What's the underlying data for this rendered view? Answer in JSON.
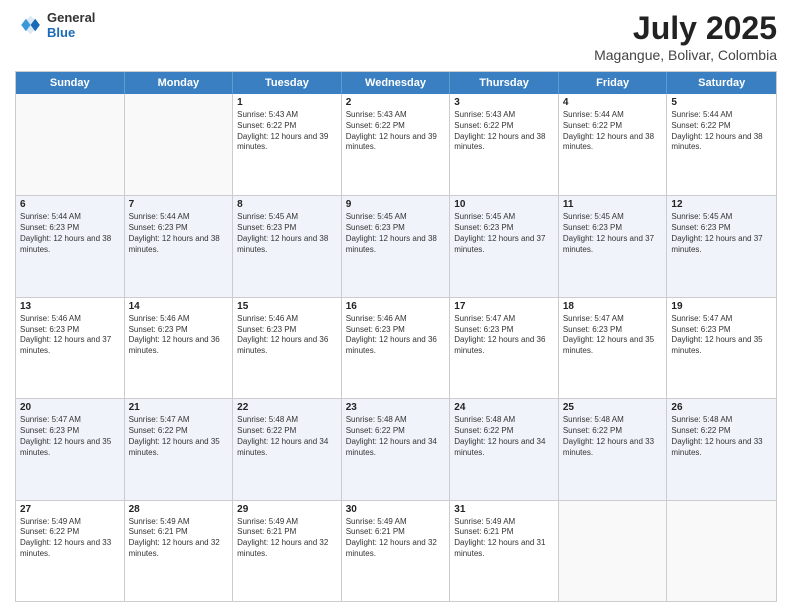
{
  "header": {
    "logo_general": "General",
    "logo_blue": "Blue",
    "month_year": "July 2025",
    "location": "Magangue, Bolivar, Colombia"
  },
  "days_of_week": [
    "Sunday",
    "Monday",
    "Tuesday",
    "Wednesday",
    "Thursday",
    "Friday",
    "Saturday"
  ],
  "weeks": [
    [
      {
        "day": "",
        "detail": ""
      },
      {
        "day": "",
        "detail": ""
      },
      {
        "day": "1",
        "detail": "Sunrise: 5:43 AM\nSunset: 6:22 PM\nDaylight: 12 hours and 39 minutes."
      },
      {
        "day": "2",
        "detail": "Sunrise: 5:43 AM\nSunset: 6:22 PM\nDaylight: 12 hours and 39 minutes."
      },
      {
        "day": "3",
        "detail": "Sunrise: 5:43 AM\nSunset: 6:22 PM\nDaylight: 12 hours and 38 minutes."
      },
      {
        "day": "4",
        "detail": "Sunrise: 5:44 AM\nSunset: 6:22 PM\nDaylight: 12 hours and 38 minutes."
      },
      {
        "day": "5",
        "detail": "Sunrise: 5:44 AM\nSunset: 6:22 PM\nDaylight: 12 hours and 38 minutes."
      }
    ],
    [
      {
        "day": "6",
        "detail": "Sunrise: 5:44 AM\nSunset: 6:23 PM\nDaylight: 12 hours and 38 minutes."
      },
      {
        "day": "7",
        "detail": "Sunrise: 5:44 AM\nSunset: 6:23 PM\nDaylight: 12 hours and 38 minutes."
      },
      {
        "day": "8",
        "detail": "Sunrise: 5:45 AM\nSunset: 6:23 PM\nDaylight: 12 hours and 38 minutes."
      },
      {
        "day": "9",
        "detail": "Sunrise: 5:45 AM\nSunset: 6:23 PM\nDaylight: 12 hours and 38 minutes."
      },
      {
        "day": "10",
        "detail": "Sunrise: 5:45 AM\nSunset: 6:23 PM\nDaylight: 12 hours and 37 minutes."
      },
      {
        "day": "11",
        "detail": "Sunrise: 5:45 AM\nSunset: 6:23 PM\nDaylight: 12 hours and 37 minutes."
      },
      {
        "day": "12",
        "detail": "Sunrise: 5:45 AM\nSunset: 6:23 PM\nDaylight: 12 hours and 37 minutes."
      }
    ],
    [
      {
        "day": "13",
        "detail": "Sunrise: 5:46 AM\nSunset: 6:23 PM\nDaylight: 12 hours and 37 minutes."
      },
      {
        "day": "14",
        "detail": "Sunrise: 5:46 AM\nSunset: 6:23 PM\nDaylight: 12 hours and 36 minutes."
      },
      {
        "day": "15",
        "detail": "Sunrise: 5:46 AM\nSunset: 6:23 PM\nDaylight: 12 hours and 36 minutes."
      },
      {
        "day": "16",
        "detail": "Sunrise: 5:46 AM\nSunset: 6:23 PM\nDaylight: 12 hours and 36 minutes."
      },
      {
        "day": "17",
        "detail": "Sunrise: 5:47 AM\nSunset: 6:23 PM\nDaylight: 12 hours and 36 minutes."
      },
      {
        "day": "18",
        "detail": "Sunrise: 5:47 AM\nSunset: 6:23 PM\nDaylight: 12 hours and 35 minutes."
      },
      {
        "day": "19",
        "detail": "Sunrise: 5:47 AM\nSunset: 6:23 PM\nDaylight: 12 hours and 35 minutes."
      }
    ],
    [
      {
        "day": "20",
        "detail": "Sunrise: 5:47 AM\nSunset: 6:23 PM\nDaylight: 12 hours and 35 minutes."
      },
      {
        "day": "21",
        "detail": "Sunrise: 5:47 AM\nSunset: 6:22 PM\nDaylight: 12 hours and 35 minutes."
      },
      {
        "day": "22",
        "detail": "Sunrise: 5:48 AM\nSunset: 6:22 PM\nDaylight: 12 hours and 34 minutes."
      },
      {
        "day": "23",
        "detail": "Sunrise: 5:48 AM\nSunset: 6:22 PM\nDaylight: 12 hours and 34 minutes."
      },
      {
        "day": "24",
        "detail": "Sunrise: 5:48 AM\nSunset: 6:22 PM\nDaylight: 12 hours and 34 minutes."
      },
      {
        "day": "25",
        "detail": "Sunrise: 5:48 AM\nSunset: 6:22 PM\nDaylight: 12 hours and 33 minutes."
      },
      {
        "day": "26",
        "detail": "Sunrise: 5:48 AM\nSunset: 6:22 PM\nDaylight: 12 hours and 33 minutes."
      }
    ],
    [
      {
        "day": "27",
        "detail": "Sunrise: 5:49 AM\nSunset: 6:22 PM\nDaylight: 12 hours and 33 minutes."
      },
      {
        "day": "28",
        "detail": "Sunrise: 5:49 AM\nSunset: 6:21 PM\nDaylight: 12 hours and 32 minutes."
      },
      {
        "day": "29",
        "detail": "Sunrise: 5:49 AM\nSunset: 6:21 PM\nDaylight: 12 hours and 32 minutes."
      },
      {
        "day": "30",
        "detail": "Sunrise: 5:49 AM\nSunset: 6:21 PM\nDaylight: 12 hours and 32 minutes."
      },
      {
        "day": "31",
        "detail": "Sunrise: 5:49 AM\nSunset: 6:21 PM\nDaylight: 12 hours and 31 minutes."
      },
      {
        "day": "",
        "detail": ""
      },
      {
        "day": "",
        "detail": ""
      }
    ]
  ]
}
